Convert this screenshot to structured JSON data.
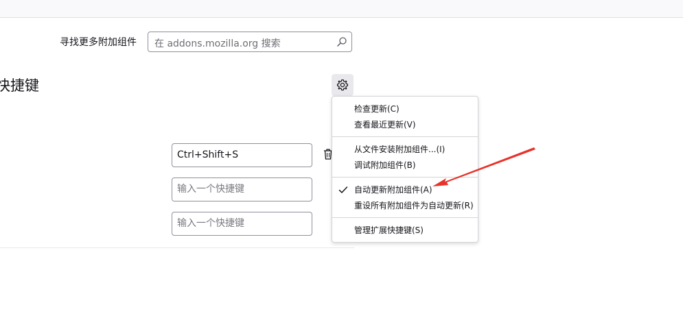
{
  "search": {
    "label": "寻找更多附加组件",
    "placeholder": "在 addons.mozilla.org 搜索"
  },
  "section": {
    "title": "快捷键"
  },
  "shortcuts": [
    {
      "value": "Ctrl+Shift+S"
    },
    {
      "placeholder": "输入一个快捷键"
    },
    {
      "placeholder": "输入一个快捷键"
    }
  ],
  "menu": {
    "items": [
      {
        "label": "检查更新(C)"
      },
      {
        "label": "查看最近更新(V)"
      },
      {
        "label": "从文件安装附加组件...(I)"
      },
      {
        "label": "调试附加组件(B)"
      },
      {
        "label": "自动更新附加组件(A)",
        "checked": true
      },
      {
        "label": "重设所有附加组件为自动更新(R)"
      },
      {
        "label": "管理扩展快捷键(S)"
      }
    ]
  },
  "annotation": {
    "arrow_color": "#e8322a"
  }
}
